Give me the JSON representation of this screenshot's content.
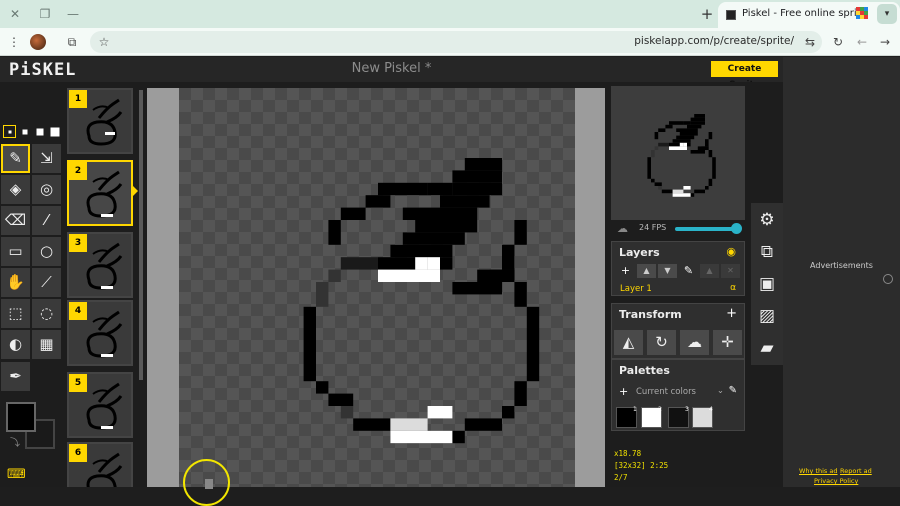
{
  "browser": {
    "tab_title": "Piskel - Free online sprite editor",
    "new_tab_symbol": "+",
    "close_symbol": "×",
    "url": "piskelapp.com/p/create/sprite/"
  },
  "app": {
    "logo": "PiSKEL",
    "sprite_name": "New Piskel *",
    "create_button": "Create Sprite"
  },
  "tools": {
    "pen_sizes": [
      1,
      2,
      3,
      4
    ],
    "selected_pen_size": 1,
    "selected_tool": "pen",
    "items": [
      "pen",
      "vertical-mirror-pen",
      "paint-bucket",
      "paint-same-color",
      "eraser",
      "stroke",
      "rectangle",
      "circle",
      "move",
      "shape-selection",
      "rectangle-selection",
      "lasso-selection",
      "lighten",
      "dithering",
      "color-picker"
    ],
    "primary_color": "#000000",
    "secondary_color": "#1a1a1a"
  },
  "frames": {
    "items": [
      {
        "num": "1"
      },
      {
        "num": "2"
      },
      {
        "num": "3"
      },
      {
        "num": "4"
      },
      {
        "num": "5"
      },
      {
        "num": "6"
      }
    ],
    "selected": 2
  },
  "preview": {
    "fps": "24 FPS",
    "fps_fraction": 0.92
  },
  "layers": {
    "title": "Layers",
    "items": [
      {
        "name": "Layer 1",
        "alpha_symbol": "α"
      }
    ]
  },
  "transform": {
    "title": "Transform",
    "add_symbol": "+"
  },
  "palettes": {
    "title": "Palettes",
    "current": "Current colors",
    "swatches": [
      {
        "num": "1",
        "color": "#000000"
      },
      {
        "num": "2",
        "color": "#ffffff"
      },
      {
        "num": "3",
        "color": "#111111"
      },
      {
        "num": "4",
        "color": "#dcdcdc"
      }
    ]
  },
  "status": {
    "zoom": "x18.78",
    "size_coords": "[32x32] 2:25",
    "frame_index": "2/7"
  },
  "ads": {
    "label": "Advertisements",
    "why_link": "Why this ad",
    "report_link": "Report ad",
    "privacy_link": "Privacy Policy"
  },
  "colors": {
    "accent": "#ffd700",
    "fps_slider": "#2ab3c8",
    "cursor_ring": "#f2e600"
  }
}
